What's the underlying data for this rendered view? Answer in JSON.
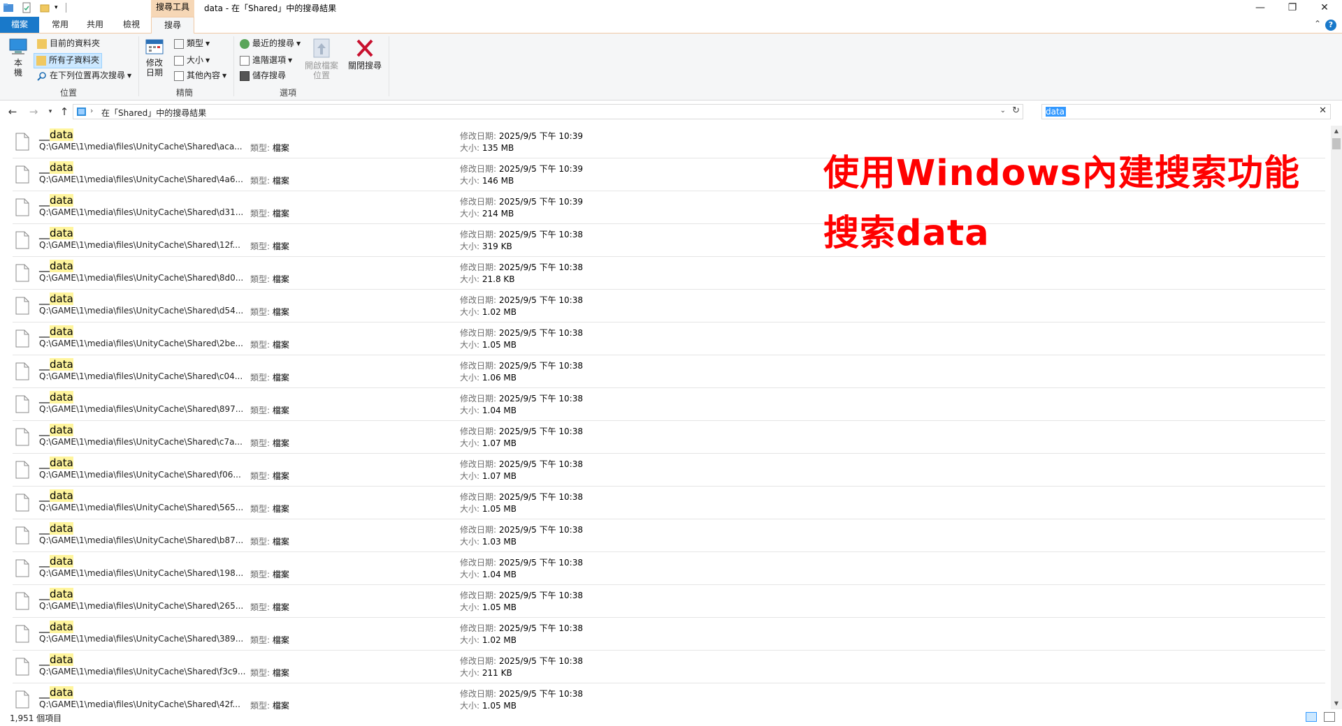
{
  "window": {
    "context_tab_label": "搜尋工具",
    "title": "data - 在「Shared」中的搜尋結果",
    "controls": {
      "minimize": "—",
      "maximize": "❐",
      "close": "✕"
    }
  },
  "ribbon_tabs": [
    "檔案",
    "常用",
    "共用",
    "檢視",
    "搜尋"
  ],
  "ribbon": {
    "location": {
      "this_pc": "本\n機",
      "current_folder": "目前的資料夾",
      "all_subfolders": "所有子資料夾",
      "search_again": "在下列位置再次搜尋",
      "group_label": "位置"
    },
    "refine": {
      "date_modified": "修改\n日期",
      "kind": "類型",
      "size": "大小",
      "other_properties": "其他內容",
      "group_label": "精簡"
    },
    "options": {
      "recent_searches": "最近的搜尋",
      "advanced_options": "進階選項",
      "save_search": "儲存搜尋",
      "open_file_location": "開啟檔案\n位置",
      "close_search": "關閉搜尋",
      "group_label": "選項"
    }
  },
  "address": {
    "path": "在「Shared」中的搜尋結果"
  },
  "search": {
    "value": "data"
  },
  "results": {
    "type_label": "類型:",
    "type_value": "檔案",
    "modified_label": "修改日期:",
    "size_label": "大小:",
    "items": [
      {
        "prefix": "__",
        "name": "data",
        "path": "Q:\\GAME\\1\\media\\files\\UnityCache\\Shared\\aca...",
        "modified": "2025/9/5 下午 10:39",
        "size": "135 MB"
      },
      {
        "prefix": "__",
        "name": "data",
        "path": "Q:\\GAME\\1\\media\\files\\UnityCache\\Shared\\4a6...",
        "modified": "2025/9/5 下午 10:39",
        "size": "146 MB"
      },
      {
        "prefix": "__",
        "name": "data",
        "path": "Q:\\GAME\\1\\media\\files\\UnityCache\\Shared\\d31...",
        "modified": "2025/9/5 下午 10:39",
        "size": "214 MB"
      },
      {
        "prefix": "__",
        "name": "data",
        "path": "Q:\\GAME\\1\\media\\files\\UnityCache\\Shared\\12f...",
        "modified": "2025/9/5 下午 10:38",
        "size": "319 KB"
      },
      {
        "prefix": "__",
        "name": "data",
        "path": "Q:\\GAME\\1\\media\\files\\UnityCache\\Shared\\8d0...",
        "modified": "2025/9/5 下午 10:38",
        "size": "21.8 KB"
      },
      {
        "prefix": "__",
        "name": "data",
        "path": "Q:\\GAME\\1\\media\\files\\UnityCache\\Shared\\d54...",
        "modified": "2025/9/5 下午 10:38",
        "size": "1.02 MB"
      },
      {
        "prefix": "__",
        "name": "data",
        "path": "Q:\\GAME\\1\\media\\files\\UnityCache\\Shared\\2be...",
        "modified": "2025/9/5 下午 10:38",
        "size": "1.05 MB"
      },
      {
        "prefix": "__",
        "name": "data",
        "path": "Q:\\GAME\\1\\media\\files\\UnityCache\\Shared\\c04...",
        "modified": "2025/9/5 下午 10:38",
        "size": "1.06 MB"
      },
      {
        "prefix": "__",
        "name": "data",
        "path": "Q:\\GAME\\1\\media\\files\\UnityCache\\Shared\\897...",
        "modified": "2025/9/5 下午 10:38",
        "size": "1.04 MB"
      },
      {
        "prefix": "__",
        "name": "data",
        "path": "Q:\\GAME\\1\\media\\files\\UnityCache\\Shared\\c7a...",
        "modified": "2025/9/5 下午 10:38",
        "size": "1.07 MB"
      },
      {
        "prefix": "__",
        "name": "data",
        "path": "Q:\\GAME\\1\\media\\files\\UnityCache\\Shared\\f06...",
        "modified": "2025/9/5 下午 10:38",
        "size": "1.07 MB"
      },
      {
        "prefix": "__",
        "name": "data",
        "path": "Q:\\GAME\\1\\media\\files\\UnityCache\\Shared\\565...",
        "modified": "2025/9/5 下午 10:38",
        "size": "1.05 MB"
      },
      {
        "prefix": "__",
        "name": "data",
        "path": "Q:\\GAME\\1\\media\\files\\UnityCache\\Shared\\b87...",
        "modified": "2025/9/5 下午 10:38",
        "size": "1.03 MB"
      },
      {
        "prefix": "__",
        "name": "data",
        "path": "Q:\\GAME\\1\\media\\files\\UnityCache\\Shared\\198...",
        "modified": "2025/9/5 下午 10:38",
        "size": "1.04 MB"
      },
      {
        "prefix": "__",
        "name": "data",
        "path": "Q:\\GAME\\1\\media\\files\\UnityCache\\Shared\\265...",
        "modified": "2025/9/5 下午 10:38",
        "size": "1.05 MB"
      },
      {
        "prefix": "__",
        "name": "data",
        "path": "Q:\\GAME\\1\\media\\files\\UnityCache\\Shared\\389...",
        "modified": "2025/9/5 下午 10:38",
        "size": "1.02 MB"
      },
      {
        "prefix": "__",
        "name": "data",
        "path": "Q:\\GAME\\1\\media\\files\\UnityCache\\Shared\\f3c9...",
        "modified": "2025/9/5 下午 10:38",
        "size": "211 KB"
      },
      {
        "prefix": "__",
        "name": "data",
        "path": "Q:\\GAME\\1\\media\\files\\UnityCache\\Shared\\42f...",
        "modified": "2025/9/5 下午 10:38",
        "size": "1.05 MB"
      }
    ]
  },
  "annotation": {
    "line1": "使用Windows內建搜索功能",
    "line2": "搜索data",
    "color": "#ff0000"
  },
  "status": {
    "count": "1,951 個項目"
  },
  "colors": {
    "accent": "#1979ca",
    "highlight": "#fff59d",
    "context_tab": "#f6d7b6"
  }
}
